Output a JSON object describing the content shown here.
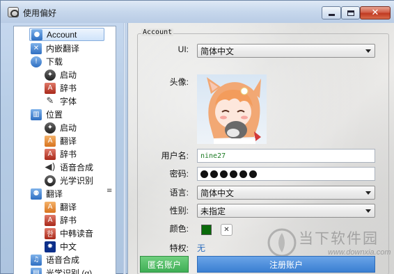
{
  "window": {
    "title": "使用偏好",
    "controls": {
      "minimize": "",
      "maximize": "",
      "close": "✕"
    }
  },
  "tree": {
    "items": [
      {
        "label": "Account",
        "icon": "user-icon",
        "level": 0,
        "selected": true
      },
      {
        "label": "内嵌翻译",
        "icon": "translate-tools-icon",
        "level": 0
      },
      {
        "label": "下载",
        "icon": "download-icon",
        "level": 0
      },
      {
        "label": "启动",
        "icon": "gear-icon",
        "level": 1
      },
      {
        "label": "辞书",
        "icon": "dictionary-icon",
        "level": 1
      },
      {
        "label": "字体",
        "icon": "font-icon",
        "level": 1
      },
      {
        "label": "位置",
        "icon": "trash-icon",
        "level": 0
      },
      {
        "label": "启动",
        "icon": "gear-icon",
        "level": 1
      },
      {
        "label": "翻译",
        "icon": "translation-icon",
        "level": 1
      },
      {
        "label": "辞书",
        "icon": "dictionary-icon",
        "level": 1
      },
      {
        "label": "语音合成",
        "icon": "speaker-icon",
        "level": 1
      },
      {
        "label": "光学识别",
        "icon": "lens-icon",
        "level": 1
      },
      {
        "label": "翻译",
        "icon": "people-icon",
        "level": 0
      },
      {
        "label": "翻译",
        "icon": "translation-icon",
        "level": 1
      },
      {
        "label": "辞书",
        "icon": "dictionary-icon",
        "level": 1
      },
      {
        "label": "中韩读音",
        "icon": "korean-icon",
        "level": 1
      },
      {
        "label": "中文",
        "icon": "sparkle-icon",
        "level": 1
      },
      {
        "label": "语音合成",
        "icon": "music-icon",
        "level": 0
      },
      {
        "label": "光学识别 (α)",
        "icon": "ocr-icon",
        "level": 0
      }
    ],
    "scroll_grip": "≡"
  },
  "account": {
    "group_title": "Account",
    "ui_label": "UI:",
    "ui_value": "简体中文",
    "avatar_label": "头像:",
    "username_label": "用户名:",
    "username_value": "nine27",
    "password_label": "密码:",
    "language_label": "语言:",
    "language_value": "简体中文",
    "gender_label": "性别:",
    "gender_value": "未指定",
    "color_label": "颜色:",
    "color_value": "#0a6a0a",
    "color_clear": "✕",
    "privilege_label": "特权:",
    "privilege_value": "无",
    "anonymous_button": "匿名账户",
    "register_button": "注册账户"
  },
  "watermark": {
    "text": "当下软件园",
    "url": "www.downxia.com"
  }
}
